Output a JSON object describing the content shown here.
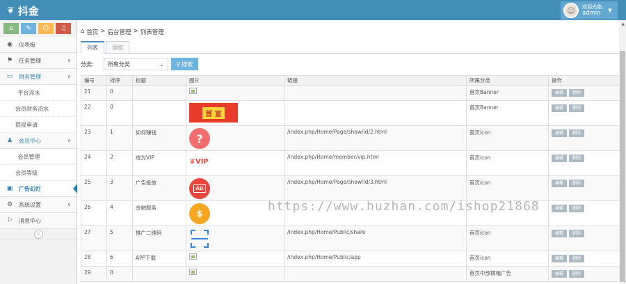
{
  "header": {
    "brand": "抖金",
    "welcome": "欢迎光临,",
    "username": "admin"
  },
  "shortcuts": [
    {
      "icon": "home-icon",
      "glyph": "⌂",
      "color": "#87b87f"
    },
    {
      "icon": "pencil-icon",
      "glyph": "✎",
      "color": "#6fb3e0"
    },
    {
      "icon": "users-icon",
      "glyph": "☺",
      "color": "#ffb752"
    },
    {
      "icon": "bell-icon",
      "glyph": "♪",
      "color": "#d15b47"
    }
  ],
  "nav": {
    "dashboard": "仪表板",
    "task": "任务管理",
    "finance": "财务管理",
    "finance_subs": [
      "平台流水",
      "会员财务流水",
      "提现申请"
    ],
    "member": "会员中心",
    "member_subs": [
      "会员管理",
      "会员等级"
    ],
    "ads": "广告幻灯",
    "system": "系统设置",
    "messages": "消息中心"
  },
  "breadcrumb": {
    "home": "首页",
    "sep": ">",
    "admin": "后台管理",
    "list": "列表管理"
  },
  "tabs": {
    "list": "列表",
    "add": "添加"
  },
  "filter": {
    "label": "分类:",
    "select_value": "所有分类",
    "search_label": "搜索"
  },
  "table": {
    "headers": [
      "编号",
      "排序",
      "标题",
      "图片",
      "链接",
      "所属分类",
      "操作"
    ],
    "rows": [
      {
        "id": "21",
        "sort": "0",
        "title": "",
        "image": "broken",
        "link": "",
        "category": "首页Banner"
      },
      {
        "id": "22",
        "sort": "0",
        "title": "",
        "image": "banner",
        "link": "",
        "category": "首页Banner"
      },
      {
        "id": "23",
        "sort": "1",
        "title": "如何赚钱",
        "image": "question",
        "link": "/index.php/Home/Page/show/id/2.html",
        "category": "首页icon"
      },
      {
        "id": "24",
        "sort": "2",
        "title": "成为VIP",
        "image": "vip",
        "link": "/index.php/Home/member/vip.html",
        "category": "首页icon"
      },
      {
        "id": "25",
        "sort": "3",
        "title": "广告投放",
        "image": "ad",
        "link": "/index.php/Home/Page/show/id/3.html",
        "category": "首页icon"
      },
      {
        "id": "26",
        "sort": "4",
        "title": "金融服务",
        "image": "money",
        "link": "",
        "category": ""
      },
      {
        "id": "27",
        "sort": "5",
        "title": "推广二维码",
        "image": "scan",
        "link": "/index.php/Home/Public/share",
        "category": "首页icon"
      },
      {
        "id": "28",
        "sort": "6",
        "title": "APP下载",
        "image": "broken",
        "link": "/index.php/Home/Public/app",
        "category": "首页icon"
      },
      {
        "id": "29",
        "sort": "0",
        "title": "",
        "image": "broken",
        "link": "",
        "category": "首页中部横幅广告"
      }
    ],
    "edit_label": "编辑",
    "delete_label": "删除"
  },
  "banner_text": "首 宣",
  "vip_text": "VIP",
  "ad_text": "AD",
  "watermark": "https://www.huzhan.com/ishop21868",
  "colors": {
    "header": "#438eb9",
    "accent": "#6fb3e0",
    "active": "#2b7dbc",
    "thumb_red": "#e8453c",
    "thumb_orange": "#f5a623"
  }
}
